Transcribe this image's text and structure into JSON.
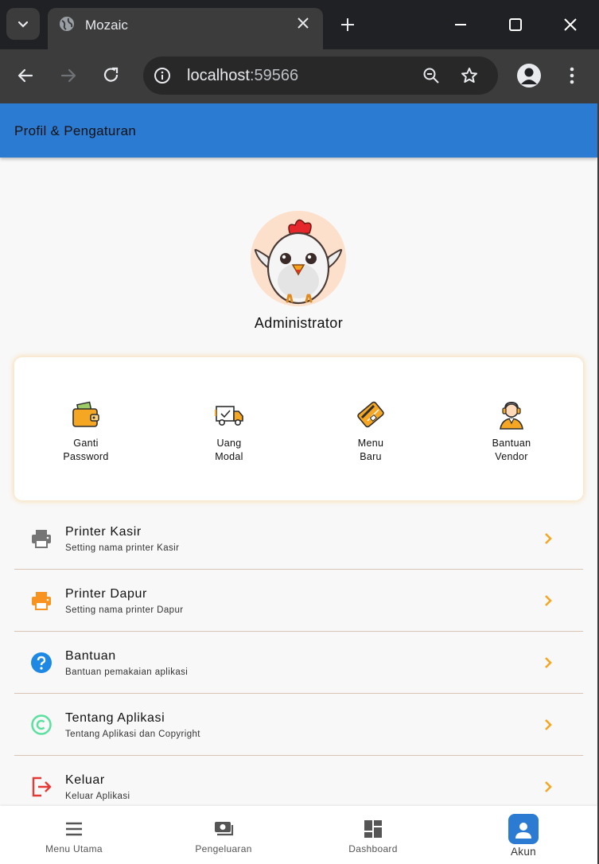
{
  "browser": {
    "tab_title": "Mozaic",
    "url_host": "localhost",
    "url_port": ":59566"
  },
  "app": {
    "header_title": "Profil & Pengaturan",
    "user_name": "Administrator",
    "quick_actions": [
      {
        "label": "Ganti\nPassword",
        "icon": "wallet-icon"
      },
      {
        "label": "Uang\nModal",
        "icon": "delivery-truck-icon"
      },
      {
        "label": "Menu\nBaru",
        "icon": "credit-card-icon"
      },
      {
        "label": "Bantuan\nVendor",
        "icon": "support-agent-icon"
      }
    ],
    "menu": [
      {
        "title": "Printer Kasir",
        "subtitle": "Setting nama printer Kasir",
        "icon": "printer-icon",
        "color": "#757575"
      },
      {
        "title": "Printer Dapur",
        "subtitle": "Setting nama printer Dapur",
        "icon": "printer-icon",
        "color": "#f7931e"
      },
      {
        "title": "Bantuan",
        "subtitle": "Bantuan pemakaian aplikasi",
        "icon": "help-icon",
        "color": "#1e88e5"
      },
      {
        "title": "Tentang Aplikasi",
        "subtitle": "Tentang Aplikasi dan Copyright",
        "icon": "copyright-icon",
        "color": "#5be0a0"
      },
      {
        "title": "Keluar",
        "subtitle": "Keluar Aplikasi",
        "icon": "logout-icon",
        "color": "#e53935"
      }
    ],
    "bottom_nav": [
      {
        "label": "Menu Utama",
        "icon": "menu-icon",
        "active": false
      },
      {
        "label": "Pengeluaran",
        "icon": "payments-icon",
        "active": false
      },
      {
        "label": "Dashboard",
        "icon": "dashboard-icon",
        "active": false
      },
      {
        "label": "Akun",
        "icon": "person-icon",
        "active": true
      }
    ],
    "colors": {
      "primary": "#2b7bd3",
      "chevron": "#f5a623"
    }
  }
}
